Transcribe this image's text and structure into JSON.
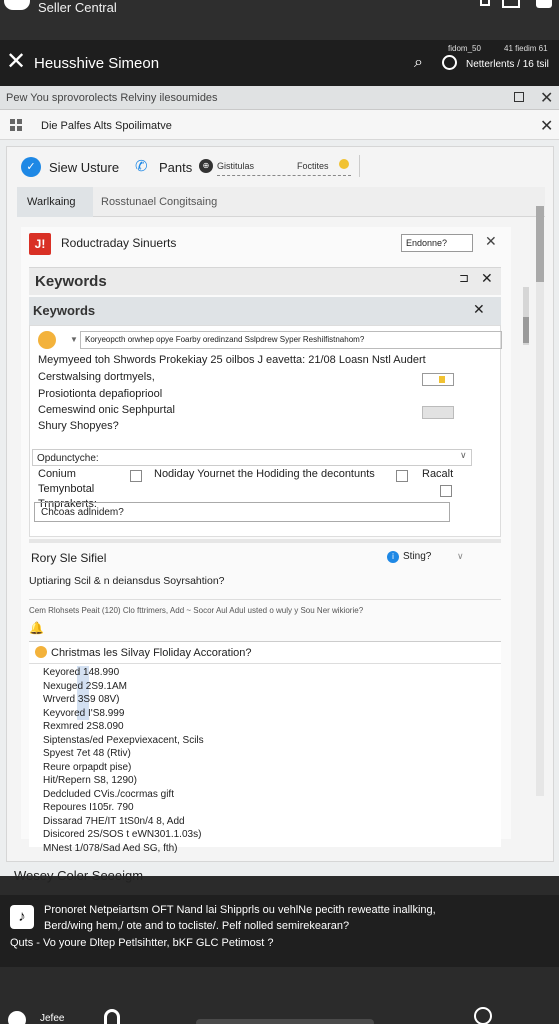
{
  "status_bar": {
    "title": "Seller Central"
  },
  "app_bar": {
    "name": "Heusshive Simeon",
    "meta_left": "fidom_50",
    "meta_right": "41 fiedim 61",
    "account": "Netterlents / 16 tsil"
  },
  "browser": {
    "url": "Pew  You sprovorolects  Relviny ilesoumides",
    "tab_label": "Die Palfes   Alts  Spoilimatve"
  },
  "nav": {
    "item1": "Siew Usture",
    "item2": "Pants",
    "chip": "⊕",
    "field_left": "Gistitulas",
    "field_right": "Foctites"
  },
  "subtabs": {
    "active": "Warlkaing",
    "other": "Rosstunael Congitsaing"
  },
  "alert": {
    "badge": "J!",
    "text": "Roductraday Sinuerts",
    "button": "Endonne?"
  },
  "keywords": {
    "title_main": "Keywords",
    "title_sub": "Keywords",
    "select_value": "Koryeopcth orwhep opye Foarby oredinzand Sslpdrew Syper Reshilfistnahom?",
    "line1": "Meymyeed toh Shwords Prokekiay 25 oilbos J eavetta: 21/08 Loasn Nstl   Audert",
    "line2": "Cerstwalsing dortmyels,",
    "line3": "Prosiotionta depafiopriool",
    "line4": "Cemeswind onic Sephpurtal",
    "line5": "Shury Shopyes?",
    "group_label": "Opdunctyche:",
    "opt1": "Conium",
    "opt2": "Nodiday Yournet the Hodiding the decontunts",
    "opt3": "Racalt",
    "opt4": "Temynbotal",
    "opt5": "Trnprakerts:",
    "input_value": "Chcoas adlnidem?"
  },
  "rs": {
    "label": "Rory Sle Sifiel",
    "help": "i",
    "right": "Sting?"
  },
  "update_text": "Uptiaring Scil & n deiansdus Soyrsahtion?",
  "header_row": "Cem Rlohsets   Peait (120)  Clo fttrimers, Add  ~ Socor Aul Adul usted o wuly y Sou Ner wikiorie?",
  "list": {
    "title": "Christmas les Silvay Floliday Accoration?",
    "items": [
      "Keyored 148.990",
      "Nexuged 2S9.1AM",
      "Wrverd 3S9 08V)",
      "Keyvored I'S8.999",
      "Rexmred 2S8.090",
      "Siptenstas/ed Pexepviexacent, Scils",
      "Spyest 7et 48 (Rtiv)",
      "Reure orpapdt pise)",
      "Hit/Repern S8, 1290)",
      "Dedcluded CVis./cocrmas gift",
      "Repoures I105r. 790",
      "Dissarad 7HE/IT 1tS0n/4 8, Add",
      "Disicored 2S/SOS t eWN301.1.03s)",
      "MNest 1/078/Sad Aed SG, fth)"
    ]
  },
  "bottom_label": "Wesey Coler Seeeigm",
  "dark_band": {
    "icon": "♪",
    "line1": "Pronoret Netpeiartsm OFT Nand lai Shipprls ou vehlNe pecith reweatte inallking,",
    "line2": "Berd/wing hem,/ ote and to tocliste/. Pelf nolled semirekearan?",
    "line3": "Quts - Vo youre Dltep Petlsihtter, bKF GLC Petimost ?"
  },
  "footer": {
    "label": "Jefee"
  }
}
